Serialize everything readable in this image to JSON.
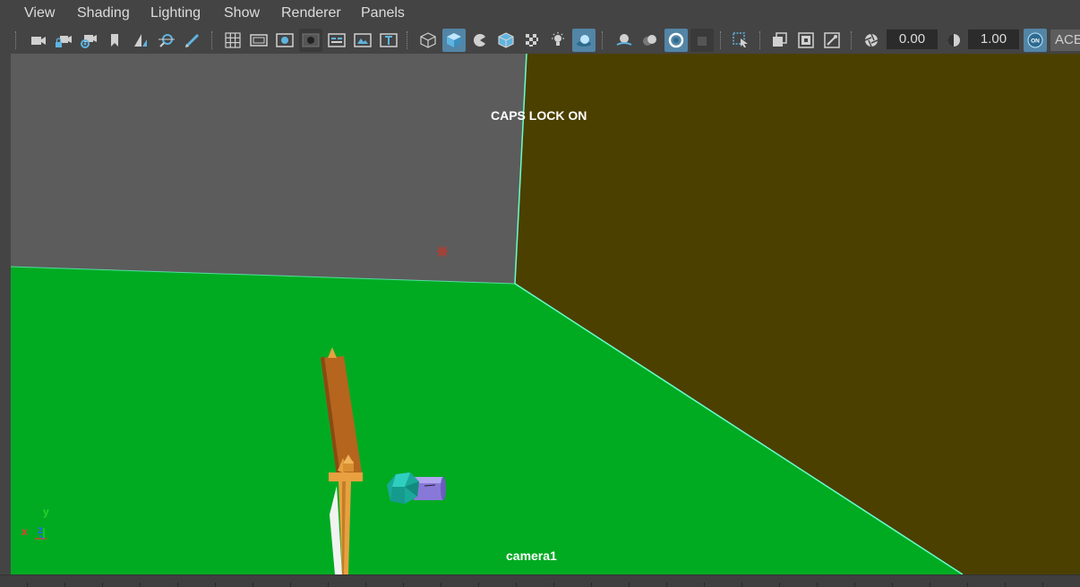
{
  "menu": {
    "items": [
      {
        "label": "View"
      },
      {
        "label": "Shading"
      },
      {
        "label": "Lighting"
      },
      {
        "label": "Show"
      },
      {
        "label": "Renderer"
      },
      {
        "label": "Panels"
      }
    ]
  },
  "toolbar": {
    "exposure_value": "0.00",
    "gamma_value": "1.00",
    "color_management_badge": "ON",
    "view_transform_label": "ACE",
    "icons": [
      "select-camera-icon",
      "lock-camera-icon",
      "camera-attributes-icon",
      "bookmark-icon",
      "image-plane-icon",
      "two-d-pan-zoom-icon",
      "grease-pencil-icon",
      "grid-icon",
      "film-gate-icon",
      "resolution-gate-icon",
      "gate-mask-icon",
      "field-chart-icon",
      "safe-action-icon",
      "safe-title-icon",
      "wireframe-icon",
      "smooth-shade-icon",
      "use-default-material-icon",
      "wireframe-on-shaded-icon",
      "textured-icon",
      "lights-icon",
      "shadows-icon",
      "screen-space-ao-icon",
      "motion-blur-icon",
      "anti-aliasing-icon",
      "depth-of-field-icon",
      "isolate-select-icon",
      "xray-icon",
      "xray-active-components-icon",
      "xray-joints-icon",
      "backface-culling-icon",
      "exposure-icon",
      "gamma-icon",
      "color-management-icon"
    ]
  },
  "viewport": {
    "caps_lock_message": "CAPS LOCK ON",
    "camera_name": "camera1",
    "axis": {
      "x": "x",
      "y": "y",
      "z": "z"
    },
    "colors": {
      "floor": "#00ab22",
      "back_wall": "#5c5c5c",
      "side_wall": "#4b4000",
      "highlight_edge": "#66ffcc",
      "wood": "#b5651d",
      "handle": "#e8a040",
      "gem": "#1aa89a",
      "cylinder": "#8878d8"
    }
  }
}
